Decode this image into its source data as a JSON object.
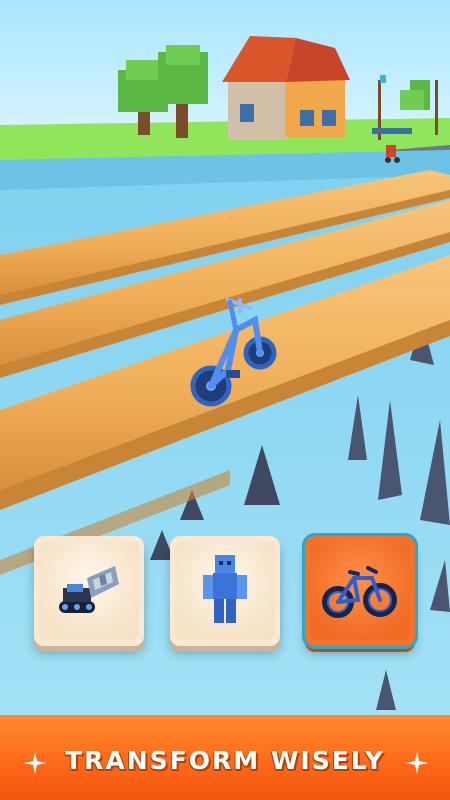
{
  "banner": {
    "text": "TRANSFORM WISELY"
  },
  "transform_options": [
    {
      "name": "drill-tank",
      "selected": false
    },
    {
      "name": "robot",
      "selected": false
    },
    {
      "name": "bicycle",
      "selected": true
    }
  ],
  "colors": {
    "sky": "#b9ecff",
    "water": "#8ed8f2",
    "grass": "#8fe65a",
    "log": "#f2b15e",
    "spike": "#4a5570",
    "banner": "#ff6a1a",
    "card": "#fbe8d2",
    "card_selected": "#f4722b"
  }
}
